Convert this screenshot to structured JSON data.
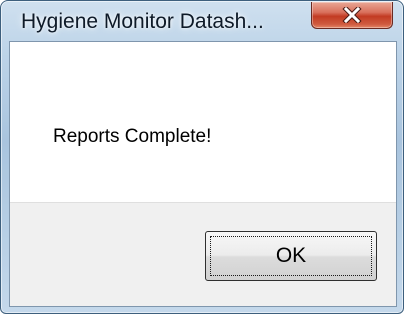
{
  "window": {
    "title": "Hygiene Monitor Datash...",
    "close_icon": "close-icon",
    "close_color": "#c23b23"
  },
  "dialog": {
    "message": "Reports Complete!",
    "ok_label": "OK"
  }
}
